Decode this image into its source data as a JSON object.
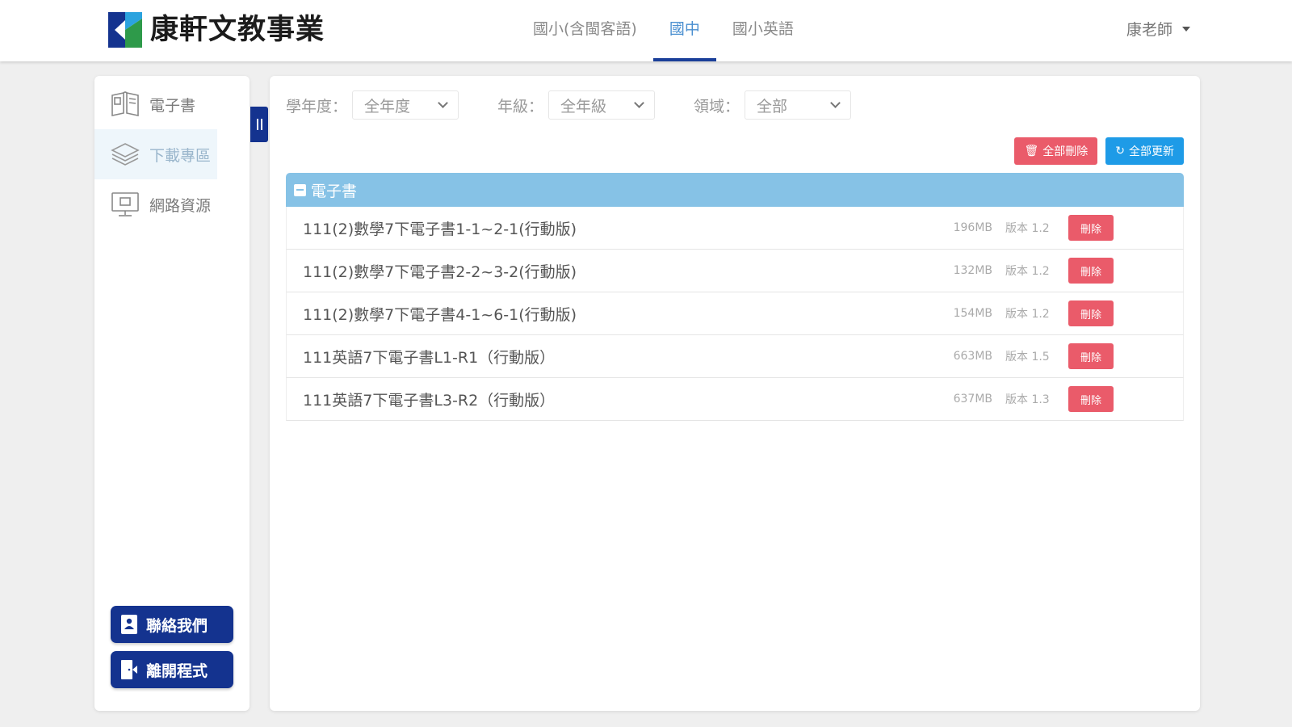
{
  "brand": {
    "name": "康軒文教事業"
  },
  "nav": {
    "tabs": [
      {
        "label": "國小(含閩客語)",
        "active": false
      },
      {
        "label": "國中",
        "active": true
      },
      {
        "label": "國小英語",
        "active": false
      }
    ]
  },
  "user": {
    "name": "康老師"
  },
  "sidebar": {
    "items": [
      {
        "label": "電子書",
        "icon": "book-icon",
        "active": false
      },
      {
        "label": "下載專區",
        "icon": "layers-icon",
        "active": true
      },
      {
        "label": "網路資源",
        "icon": "monitor-icon",
        "active": false
      }
    ],
    "contact_label": "聯絡我們",
    "exit_label": "離開程式"
  },
  "filters": {
    "year": {
      "label": "學年度：",
      "value": "全年度"
    },
    "grade": {
      "label": "年級：",
      "value": "全年級"
    },
    "domain": {
      "label": "領域：",
      "value": "全部"
    }
  },
  "actions": {
    "delete_all": "全部刪除",
    "update_all": "全部更新"
  },
  "section": {
    "title": "電子書",
    "delete_label": "刪除",
    "rows": [
      {
        "title": "111(2)數學7下電子書1-1~2-1(行動版)",
        "size": "196MB",
        "version": "版本 1.2"
      },
      {
        "title": "111(2)數學7下電子書2-2~3-2(行動版)",
        "size": "132MB",
        "version": "版本 1.2"
      },
      {
        "title": "111(2)數學7下電子書4-1~6-1(行動版)",
        "size": "154MB",
        "version": "版本 1.2"
      },
      {
        "title": "111英語7下電子書L1-R1（行動版）",
        "size": "663MB",
        "version": "版本 1.5"
      },
      {
        "title": "111英語7下電子書L3-R2（行動版）",
        "size": "637MB",
        "version": "版本 1.3"
      }
    ]
  },
  "colors": {
    "brand_blue": "#14338f",
    "accent_blue": "#1e9be7",
    "section_blue": "#86c2e6",
    "danger_red": "#ea5b6a",
    "logo_green": "#2e9a4a"
  }
}
